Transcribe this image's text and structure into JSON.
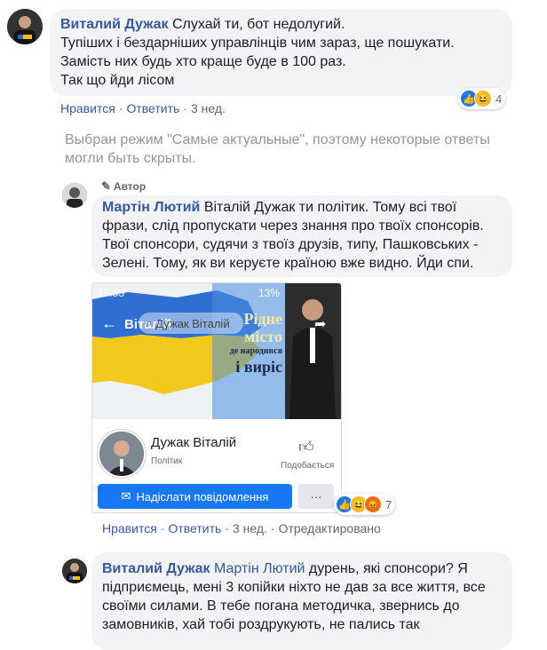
{
  "comments": [
    {
      "author": "Виталий Дужак",
      "lines": [
        "Слухай ти, бот недолугий.",
        "Тупіших і бездарніших управлінців чим зараз, ще пошукати.",
        "Замість них будь хто краще буде в 100 раз.",
        "Так що йди лісом"
      ],
      "reactions": {
        "icons": [
          "like-icon",
          "haha-icon"
        ],
        "count": "4"
      },
      "actions": {
        "like": "Нравится",
        "reply": "Ответить",
        "time": "3 нед."
      }
    }
  ],
  "notice": {
    "line1": "Выбран режим \"Самые актуальные\", поэтому некоторые ответы",
    "line2": "могли быть скрыты."
  },
  "reply1": {
    "badge": "Автор",
    "author": "Мартін Лютий",
    "lines": [
      "Віталій Дужак ти політик. Тому всі твої",
      "фрази, слід пропускати через знання про твоїх спонсорів.",
      "Твої спонсори, судячи з твоїз друзів, типу, Пашковських -",
      "Зелені. Тому, як ви керуєте країною вже видно. Йди спи."
    ],
    "screenshot": {
      "status_time": "15:53",
      "status_battery": "13%",
      "header_name": "Віталій",
      "search_text": "Дужак Віталій",
      "banner_line1": "Рідне",
      "banner_line2": "місто",
      "banner_line3": "де народився",
      "banner_line4": "і виріс",
      "profile_name": "Дужак Віталій",
      "profile_role": "Політик",
      "like_label": "Подобається",
      "message_button": "Надіслати повідомлення",
      "more_button": "···"
    },
    "reactions": {
      "icons": [
        "like-icon",
        "haha-icon",
        "angry-icon"
      ],
      "count": "7"
    },
    "actions": {
      "like": "Нравится",
      "reply": "Ответить",
      "time": "3 нед.",
      "edited": "Отредактировано"
    }
  },
  "reply2": {
    "author": "Виталий Дужак",
    "mention": "Мартін Лютий",
    "line1_rest": "дурень, які спонсори? Я",
    "lines": [
      "підприємець, мені 3 копійки ніхто не дав за все життя, все",
      "своїми силами. В тебе погана методичка, звернись до",
      "замовників, хай тобі роздрукують, не пались так"
    ]
  },
  "colors": {
    "link": "#385898",
    "fb_blue": "#1877f2",
    "bubble": "#f2f3f5",
    "meta": "#606770"
  }
}
